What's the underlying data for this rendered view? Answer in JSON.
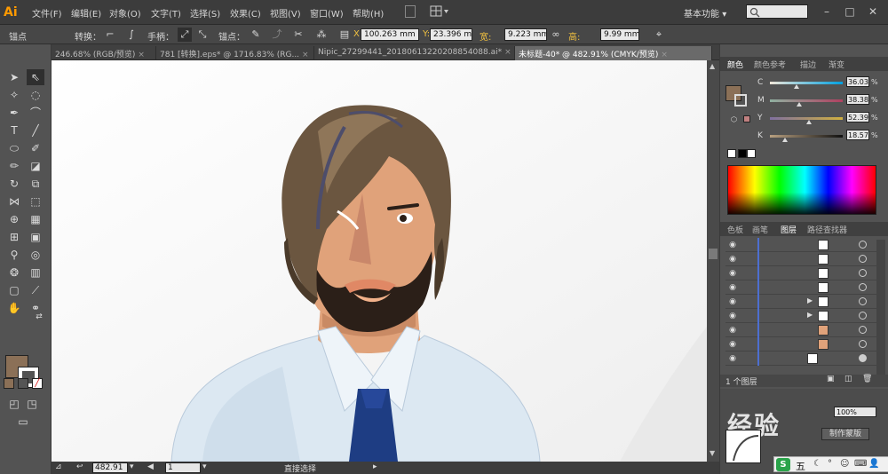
{
  "app": {
    "logo": "Ai",
    "menus": [
      "文件(F)",
      "编辑(E)",
      "对象(O)",
      "文字(T)",
      "选择(S)",
      "效果(C)",
      "视图(V)",
      "窗口(W)",
      "帮助(H)"
    ],
    "workspace": "基本功能",
    "workspace_arrow": "▾",
    "window_buttons": [
      "–",
      "□",
      "✕"
    ]
  },
  "control_bar": {
    "selection_label": "锚点",
    "convert_label": "转换：",
    "handles_label": "手柄：",
    "anchor_label": "锚点：",
    "x_label": "X:",
    "x_value": "100.263",
    "y_label": "Y:",
    "y_value": "23.396",
    "w_label": "宽:",
    "w_value": "9.223",
    "h_label": "高:",
    "h_value": "9.99",
    "units": "mm"
  },
  "tabs": [
    {
      "label": "246.68% (RGB/预览)",
      "active": false
    },
    {
      "label": "781 [转换].eps* @ 1716.83% (RG...",
      "active": false
    },
    {
      "label": "Nipic_27299441_20180613220208854088.ai*",
      "active": false
    },
    {
      "label": "未标题-40* @ 482.91% (CMYK/预览)",
      "active": true
    }
  ],
  "status_bar": {
    "zoom": "482.91",
    "page": "1",
    "tool_name": "直接选择"
  },
  "color_panel": {
    "tabs": [
      "颜色",
      "颜色参考",
      "描边",
      "渐变"
    ],
    "sliders": [
      {
        "label": "C",
        "value": "36.03"
      },
      {
        "label": "M",
        "value": "38.38"
      },
      {
        "label": "Y",
        "value": "52.39"
      },
      {
        "label": "K",
        "value": "18.57"
      }
    ],
    "percent": "%",
    "fill_color": "#8b7057"
  },
  "layers_panel": {
    "tabs": [
      "色板",
      "画笔",
      "图层",
      "路径查找器"
    ],
    "footer": "1 个图层",
    "rows": 10
  },
  "bottom_panel": {
    "percent_value": "100%",
    "button_label": "制作蒙版",
    "watermark_text": "经验",
    "ime_labels": [
      "五"
    ]
  },
  "colors": {
    "hair": "#6b5640",
    "skin": "#e0a27a",
    "beard": "#2b1f18",
    "shirt": "#dce8f2",
    "tie": "#1e3d83"
  }
}
